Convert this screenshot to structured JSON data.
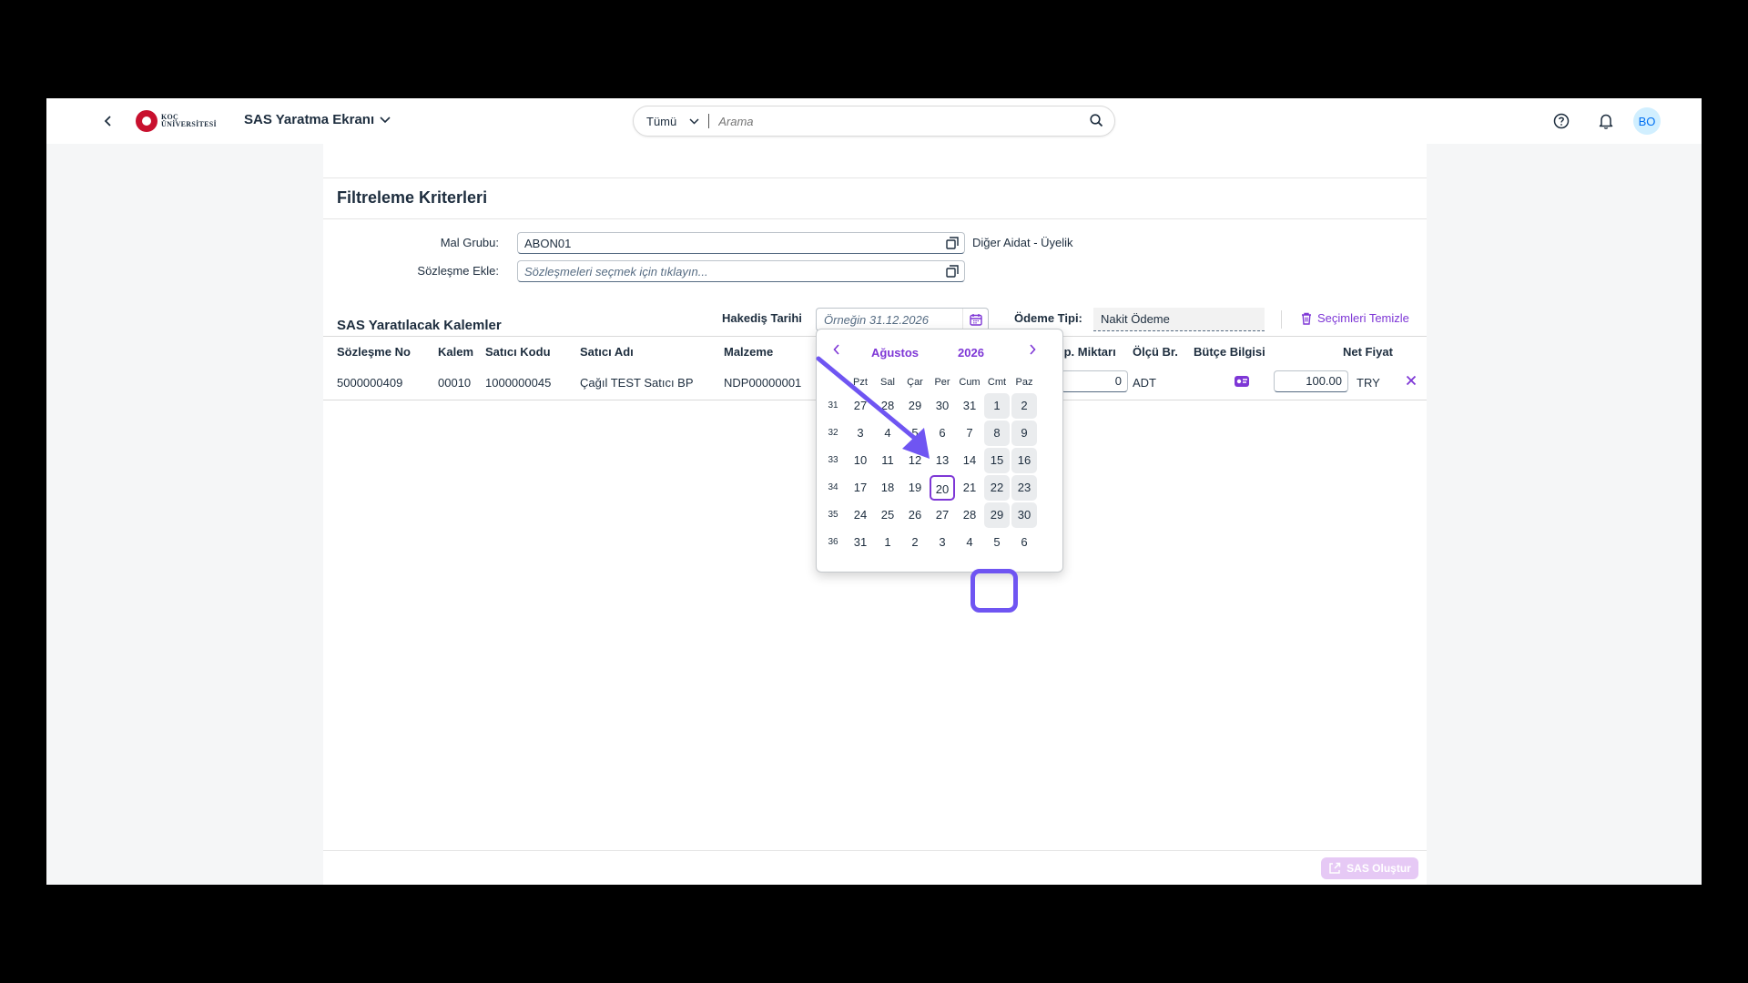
{
  "shell": {
    "logo_line1": "KOÇ",
    "logo_line2": "ÜNİVERSİTESİ",
    "app_title": "SAS Yaratma Ekranı",
    "search_scope": "Tümü",
    "search_placeholder": "Arama",
    "avatar_initials": "BO"
  },
  "filter": {
    "title": "Filtreleme Kriterleri",
    "mal_grubu_label": "Mal Grubu:",
    "mal_grubu_value": "ABON01",
    "mal_grubu_desc": "Diğer Aidat - Üyelik",
    "sozlesme_label": "Sözleşme Ekle:",
    "sozlesme_placeholder": "Sözleşmeleri seçmek için tıklayın..."
  },
  "toolbar": {
    "title": "SAS Yaratılacak Kalemler",
    "hakedis_label": "Hakediş Tarihi",
    "hakedis_placeholder": "Örneğin 31.12.2026",
    "odeme_label": "Ödeme Tipi:",
    "odeme_value": "Nakit Ödeme",
    "clear_label": "Seçimleri Temizle"
  },
  "table": {
    "columns": {
      "sozlesme_no": "Sözleşme No",
      "kalem": "Kalem",
      "satici_kodu": "Satıcı Kodu",
      "satici_adi": "Satıcı Adı",
      "malzeme": "Malzeme",
      "sip_miktari": "ip. Miktarı",
      "olcu_br": "Ölçü Br.",
      "butce_bilgisi": "Bütçe Bilgisi",
      "net_fiyat": "Net Fiyat"
    },
    "rows": [
      {
        "sozlesme_no": "5000000409",
        "kalem": "00010",
        "satici_kodu": "1000000045",
        "satici_adi": "Çağıl TEST Satıcı BP",
        "malzeme": "NDP00000001",
        "sip_miktari": "0",
        "olcu_br": "ADT",
        "net_fiyat": "100.00",
        "currency": "TRY"
      }
    ]
  },
  "footer": {
    "create_label": "SAS Oluştur"
  },
  "calendar": {
    "month": "Ağustos",
    "year": "2026",
    "weekdays": [
      "Pzt",
      "Sal",
      "Çar",
      "Per",
      "Cum",
      "Cmt",
      "Paz"
    ],
    "weeks": [
      {
        "no": "31",
        "days": [
          "27",
          "28",
          "29",
          "30",
          "31",
          "1",
          "2"
        ]
      },
      {
        "no": "32",
        "days": [
          "3",
          "4",
          "5",
          "6",
          "7",
          "8",
          "9"
        ]
      },
      {
        "no": "33",
        "days": [
          "10",
          "11",
          "12",
          "13",
          "14",
          "15",
          "16"
        ]
      },
      {
        "no": "34",
        "days": [
          "17",
          "18",
          "19",
          "20",
          "21",
          "22",
          "23"
        ]
      },
      {
        "no": "35",
        "days": [
          "24",
          "25",
          "26",
          "27",
          "28",
          "29",
          "30"
        ]
      },
      {
        "no": "36",
        "days": [
          "31",
          "1",
          "2",
          "3",
          "4",
          "5",
          "6"
        ]
      }
    ],
    "selected_day": "20"
  },
  "colors": {
    "accent": "#7e37d6",
    "annotation": "#6f55f2",
    "weekend_bg": "#eaecee"
  }
}
